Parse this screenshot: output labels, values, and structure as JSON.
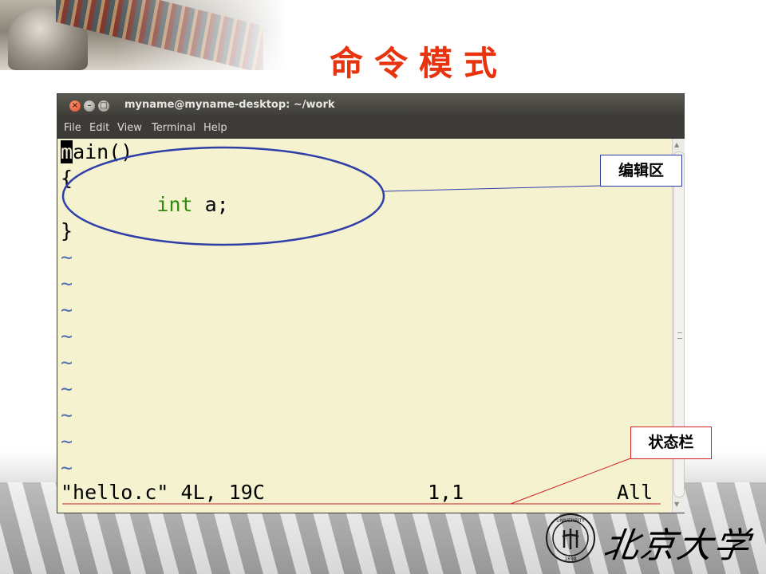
{
  "slide": {
    "title": "命令模式",
    "title_color": "#e8330f"
  },
  "window": {
    "title": "myname@myname-desktop: ~/work",
    "close_glyph": "×",
    "min_glyph": "–",
    "max_glyph": "□",
    "menu": [
      "File",
      "Edit",
      "View",
      "Terminal",
      "Help"
    ]
  },
  "editor": {
    "cursor_char": "m",
    "line1_rest": "ain()",
    "line2": "{",
    "line3_indent": "        ",
    "line3_keyword": "int",
    "line3_rest": " a;",
    "line4": "}",
    "tilde": "~",
    "tilde_count": 9,
    "keyword_color": "#2e8b12",
    "tilde_color": "#4a6fb5",
    "background": "#f5f2d0"
  },
  "statusline": {
    "file_info": "\"hello.c\" 4L, 19C",
    "position": "1,1",
    "scroll": "All"
  },
  "annotations": {
    "edit_area": "编辑区",
    "status_bar": "状态栏",
    "ellipse_color": "#2f3fa8",
    "status_line_color": "#d02020"
  },
  "logo": {
    "text": "北京大学",
    "seal_year": "1898",
    "seal_motto": "UNIVERSITY"
  },
  "icons": [
    "close-icon",
    "minimize-icon",
    "maximize-icon",
    "scroll-up-icon",
    "scroll-down-icon",
    "university-seal-icon"
  ]
}
